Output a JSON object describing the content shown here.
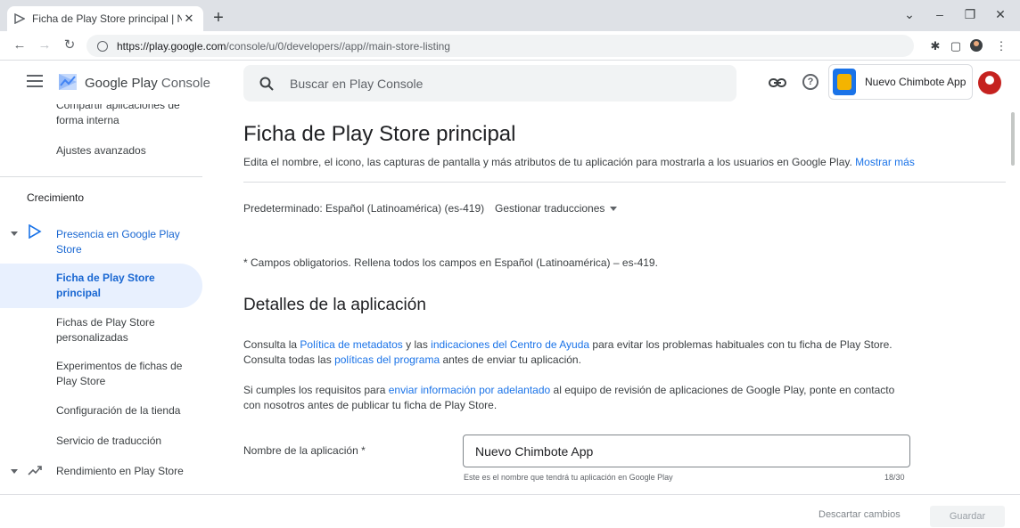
{
  "browser": {
    "tab_title": "Ficha de Play Store principal | Nu",
    "new_tab": "+",
    "url_host": "https://play.google.com",
    "url_path": "/console/u/0/developers//app//main-store-listing"
  },
  "header": {
    "logo_google_play": "Google Play",
    "logo_console": "Console",
    "search_placeholder": "Buscar en Play Console",
    "help_glyph": "?",
    "app_name": "Nuevo Chimbote App"
  },
  "sidebar": {
    "partial_item": "Compartir aplicaciones de",
    "item_internal": "forma interna",
    "item_advanced": "Ajustes avanzados",
    "section_growth": "Crecimiento",
    "group_presence_line1": "Presencia en Google Play",
    "group_presence_line2": "Store",
    "item_main_listing_line1": "Ficha de Play Store",
    "item_main_listing_line2": "principal",
    "item_custom_line1": "Fichas de Play Store",
    "item_custom_line2": "personalizadas",
    "item_experiments_line1": "Experimentos de fichas de",
    "item_experiments_line2": "Play Store",
    "item_store_settings": "Configuración de la tienda",
    "item_translation": "Servicio de traducción",
    "group_performance": "Rendimiento en Play Store"
  },
  "main": {
    "title": "Ficha de Play Store principal",
    "subtitle": "Edita el nombre, el icono, las capturas de pantalla y más atributos de tu aplicación para mostrarla a los usuarios en Google Play.",
    "show_more": "Mostrar más",
    "default_lang": "Predeterminado: Español (Latinoamérica) (es-419)",
    "manage_translations": "Gestionar traducciones",
    "required_note": "* Campos obligatorios. Rellena todos los campos en Español (Latinoamérica) – es-419.",
    "section_title": "Detalles de la aplicación",
    "p1_a": "Consulta la",
    "p1_link1": "Política de metadatos",
    "p1_b": "y las",
    "p1_link2": "indicaciones del Centro de Ayuda",
    "p1_c": "para evitar los problemas habituales con tu ficha de Play Store.",
    "p2_a": "Consulta todas las",
    "p2_link": "políticas del programa",
    "p2_b": "antes de enviar tu aplicación.",
    "p3_a": "Si cumples los requisitos para",
    "p3_link": "enviar información por adelantado",
    "p3_b": "al equipo de revisión de aplicaciones de Google Play, ponte en contacto",
    "p3_c": "con nosotros antes de publicar tu ficha de Play Store.",
    "name_label": "Nombre de la aplicación *",
    "name_value": "Nuevo Chimbote App",
    "name_helper": "Este es el nombre que tendrá tu aplicación en Google Play",
    "name_counter": "18/30"
  },
  "footer": {
    "discard": "Descartar cambios",
    "save": "Guardar"
  }
}
